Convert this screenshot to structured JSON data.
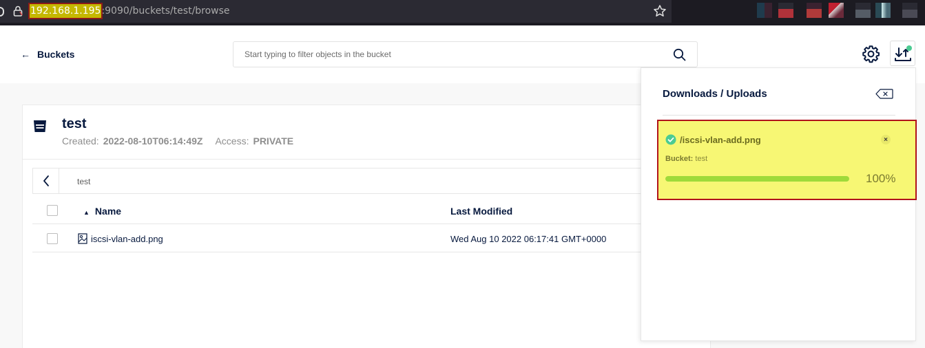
{
  "browser": {
    "url_host": "192.168.1.195",
    "url_rest": ":9090/buckets/test/browse"
  },
  "header": {
    "back_label": "Buckets",
    "search_placeholder": "Start typing to filter objects in the bucket"
  },
  "bucket": {
    "name": "test",
    "created_label": "Created:",
    "created_value": "2022-08-10T06:14:49Z",
    "access_label": "Access:",
    "access_value": "PRIVATE"
  },
  "breadcrumb": {
    "path": "test"
  },
  "table": {
    "columns": {
      "name": "Name",
      "last_modified": "Last Modified"
    },
    "rows": [
      {
        "name": "iscsi-vlan-add.png",
        "last_modified": "Wed Aug 10 2022 06:17:41 GMT+0000"
      }
    ]
  },
  "transfers": {
    "title": "Downloads / Uploads",
    "items": [
      {
        "name": "/iscsi-vlan-add.png",
        "bucket_label": "Bucket:",
        "bucket_value": "test",
        "progress": 1.0,
        "percent_text": "100%"
      }
    ]
  },
  "colors": {
    "accent": "#07193e",
    "success": "#4ccb92",
    "highlight": "#f7f774",
    "highlight_border": "#b0121b"
  }
}
